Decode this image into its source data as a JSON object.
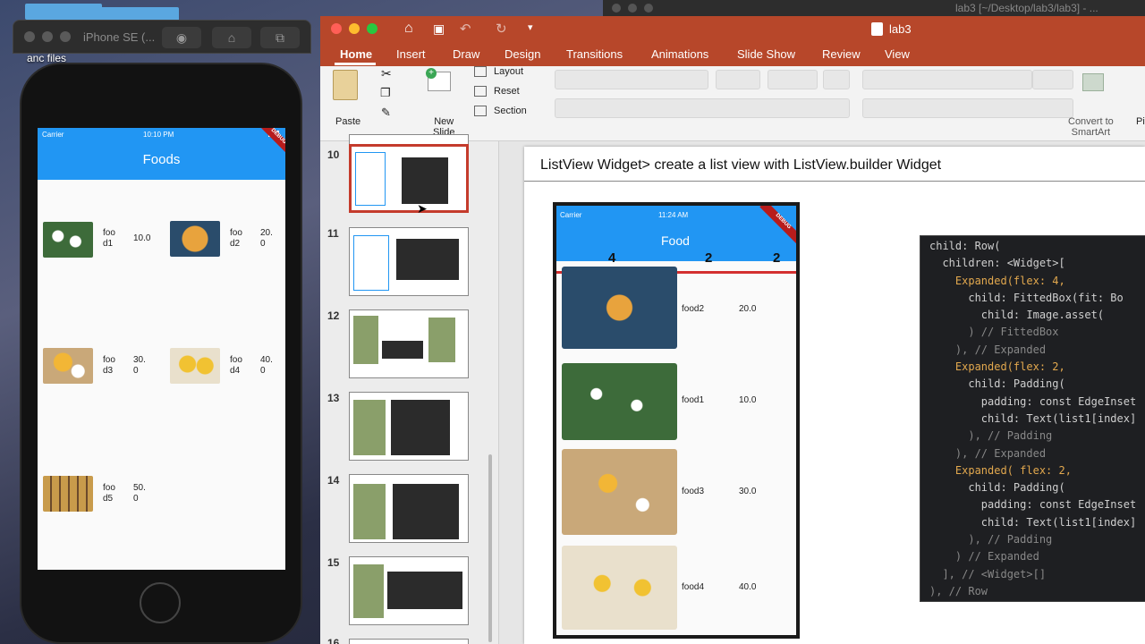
{
  "desktop": {
    "files_label": "anc files"
  },
  "background_window": {
    "title": "lab3 [~/Desktop/lab3/lab3] - ..."
  },
  "simulator": {
    "title": "iPhone SE (...",
    "screen": {
      "status_carrier": "Carrier",
      "status_time": "10:10 PM",
      "debug_label": "DEBUG",
      "appbar_title": "Foods",
      "items": [
        {
          "name_line1": "foo",
          "name_line2": "d1",
          "price": "10.0"
        },
        {
          "name_line1": "foo",
          "name_line2": "d2",
          "price_line1": "20.",
          "price_line2": "0"
        },
        {
          "name_line1": "foo",
          "name_line2": "d3",
          "price_line1": "30.",
          "price_line2": "0"
        },
        {
          "name_line1": "foo",
          "name_line2": "d4",
          "price_line1": "40.",
          "price_line2": "0"
        },
        {
          "name_line1": "foo",
          "name_line2": "d5",
          "price_line1": "50.",
          "price_line2": "0"
        }
      ]
    }
  },
  "powerpoint": {
    "doc_title": "lab3",
    "tabs": [
      "Home",
      "Insert",
      "Draw",
      "Design",
      "Transitions",
      "Animations",
      "Slide Show",
      "Review",
      "View"
    ],
    "active_tab": "Home",
    "ribbon": {
      "paste": "Paste",
      "new_slide_line1": "New",
      "new_slide_line2": "Slide",
      "layout": "Layout",
      "reset": "Reset",
      "section": "Section",
      "convert_line1": "Convert to",
      "convert_line2": "SmartArt",
      "picture_cut": "Pi"
    },
    "slides": [
      "10",
      "11",
      "12",
      "13",
      "14",
      "15",
      "16"
    ],
    "selected_slide": "10",
    "slide": {
      "title": "ListView Widget> create a list view with ListView.builder Widget",
      "phone": {
        "carrier": "Carrier",
        "time": "11:24 AM",
        "debug": "DEBUG",
        "appbar": "Food",
        "flex_labels": [
          "4",
          "2",
          "2"
        ],
        "rows": [
          {
            "name": "food2",
            "price": "20.0"
          },
          {
            "name": "food1",
            "price": "10.0"
          },
          {
            "name": "food3",
            "price": "30.0"
          },
          {
            "name": "food4",
            "price": "40.0"
          }
        ]
      },
      "code_lines": [
        "child: Row(",
        "  children: <Widget>[",
        "    Expanded(flex: 4,",
        "      child: FittedBox(fit: Bo",
        "        child: Image.asset(",
        "      ) // FittedBox",
        "    ), // Expanded",
        "    Expanded(flex: 2,",
        "      child: Padding(",
        "        padding: const EdgeInset",
        "        child: Text(list1[index]",
        "      ), // Padding",
        "    ), // Expanded",
        "    Expanded( flex: 2,",
        "      child: Padding(",
        "        padding: const EdgeInset",
        "        child: Text(list1[index]",
        "      ), // Padding",
        "    ) // Expanded",
        "  ], // <Widget>[]",
        "), // Row"
      ]
    }
  }
}
